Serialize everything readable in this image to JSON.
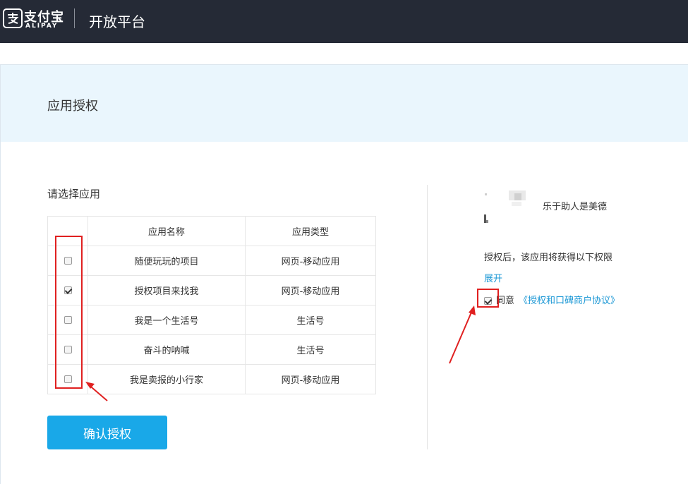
{
  "topbar": {
    "logo_cn": "支付宝",
    "logo_en": "ALIPAY",
    "title": "开放平台"
  },
  "card": {
    "title": "应用授权"
  },
  "left": {
    "select_label": "请选择应用",
    "table": {
      "headers": [
        "应用名称",
        "应用类型"
      ],
      "rows": [
        {
          "name": "随便玩玩的项目",
          "type": "网页-移动应用",
          "checked": false
        },
        {
          "name": "授权项目来找我",
          "type": "网页-移动应用",
          "checked": true
        },
        {
          "name": "我是一个生活号",
          "type": "生活号",
          "checked": false
        },
        {
          "name": "奋斗的呐喊",
          "type": "生活号",
          "checked": false
        },
        {
          "name": "我是卖报的小行家",
          "type": "网页-移动应用",
          "checked": false
        }
      ]
    },
    "confirm_button": "确认授权"
  },
  "right": {
    "username": "乐于助人是美德",
    "permission_text": "授权后，该应用将获得以下权限",
    "expand_link": "展开",
    "agree_text": "同意",
    "agree_checked": true,
    "agreement_link": "《授权和口碑商户协议》"
  },
  "colors": {
    "topbar_bg": "#252a36",
    "header_bg": "#eaf6fd",
    "accent": "#19a8e8",
    "link": "#1a97d5",
    "annotation": "#e02020"
  }
}
